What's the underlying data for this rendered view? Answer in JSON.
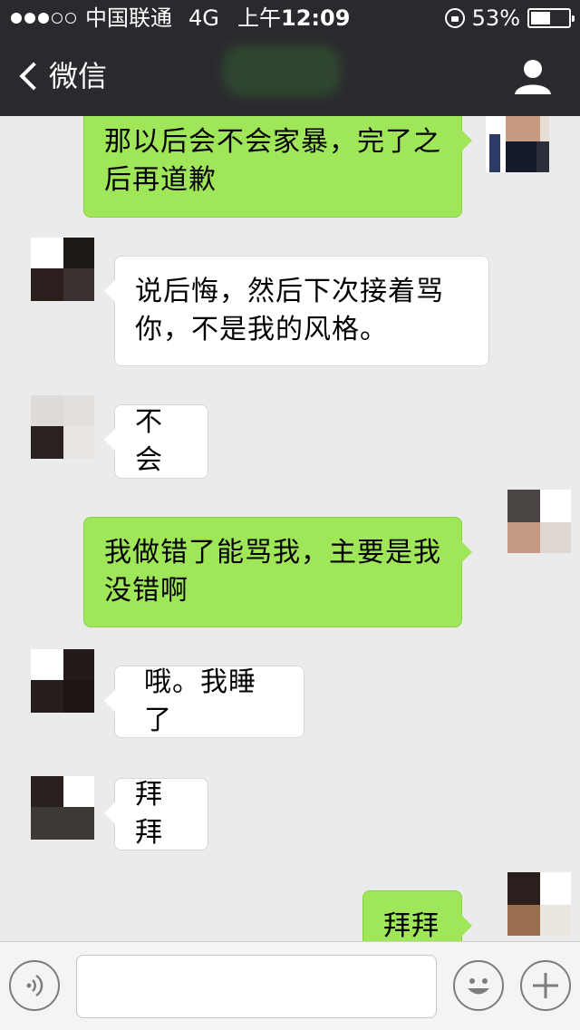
{
  "status_bar": {
    "carrier": "中国联通",
    "network": "4G",
    "time_prefix": "上午",
    "time": "12:09",
    "battery_percent": "53%",
    "battery_level": 0.53
  },
  "nav": {
    "back_label": "微信",
    "back_icon": "chevron-left-icon",
    "contact_icon": "person-icon"
  },
  "messages": [
    {
      "direction": "out",
      "text": "那以后会不会家暴，完了之后再道歉"
    },
    {
      "direction": "in",
      "text": "说后悔，然后下次接着骂你，不是我的风格。"
    },
    {
      "direction": "in",
      "text": "不会"
    },
    {
      "direction": "out",
      "text": "我做错了能骂我，主要是我没错啊"
    },
    {
      "direction": "in",
      "text": "哦。我睡了"
    },
    {
      "direction": "in",
      "text": "拜拜"
    },
    {
      "direction": "out",
      "text": "拜拜"
    }
  ],
  "input_bar": {
    "voice_icon": "voice-icon",
    "emoji_icon": "smiley-icon",
    "more_icon": "plus-icon",
    "input_value": ""
  },
  "colors": {
    "nav_bg": "#2a2a2e",
    "chat_bg": "#ebebeb",
    "bubble_out": "#9fe658",
    "bubble_in": "#ffffff"
  }
}
